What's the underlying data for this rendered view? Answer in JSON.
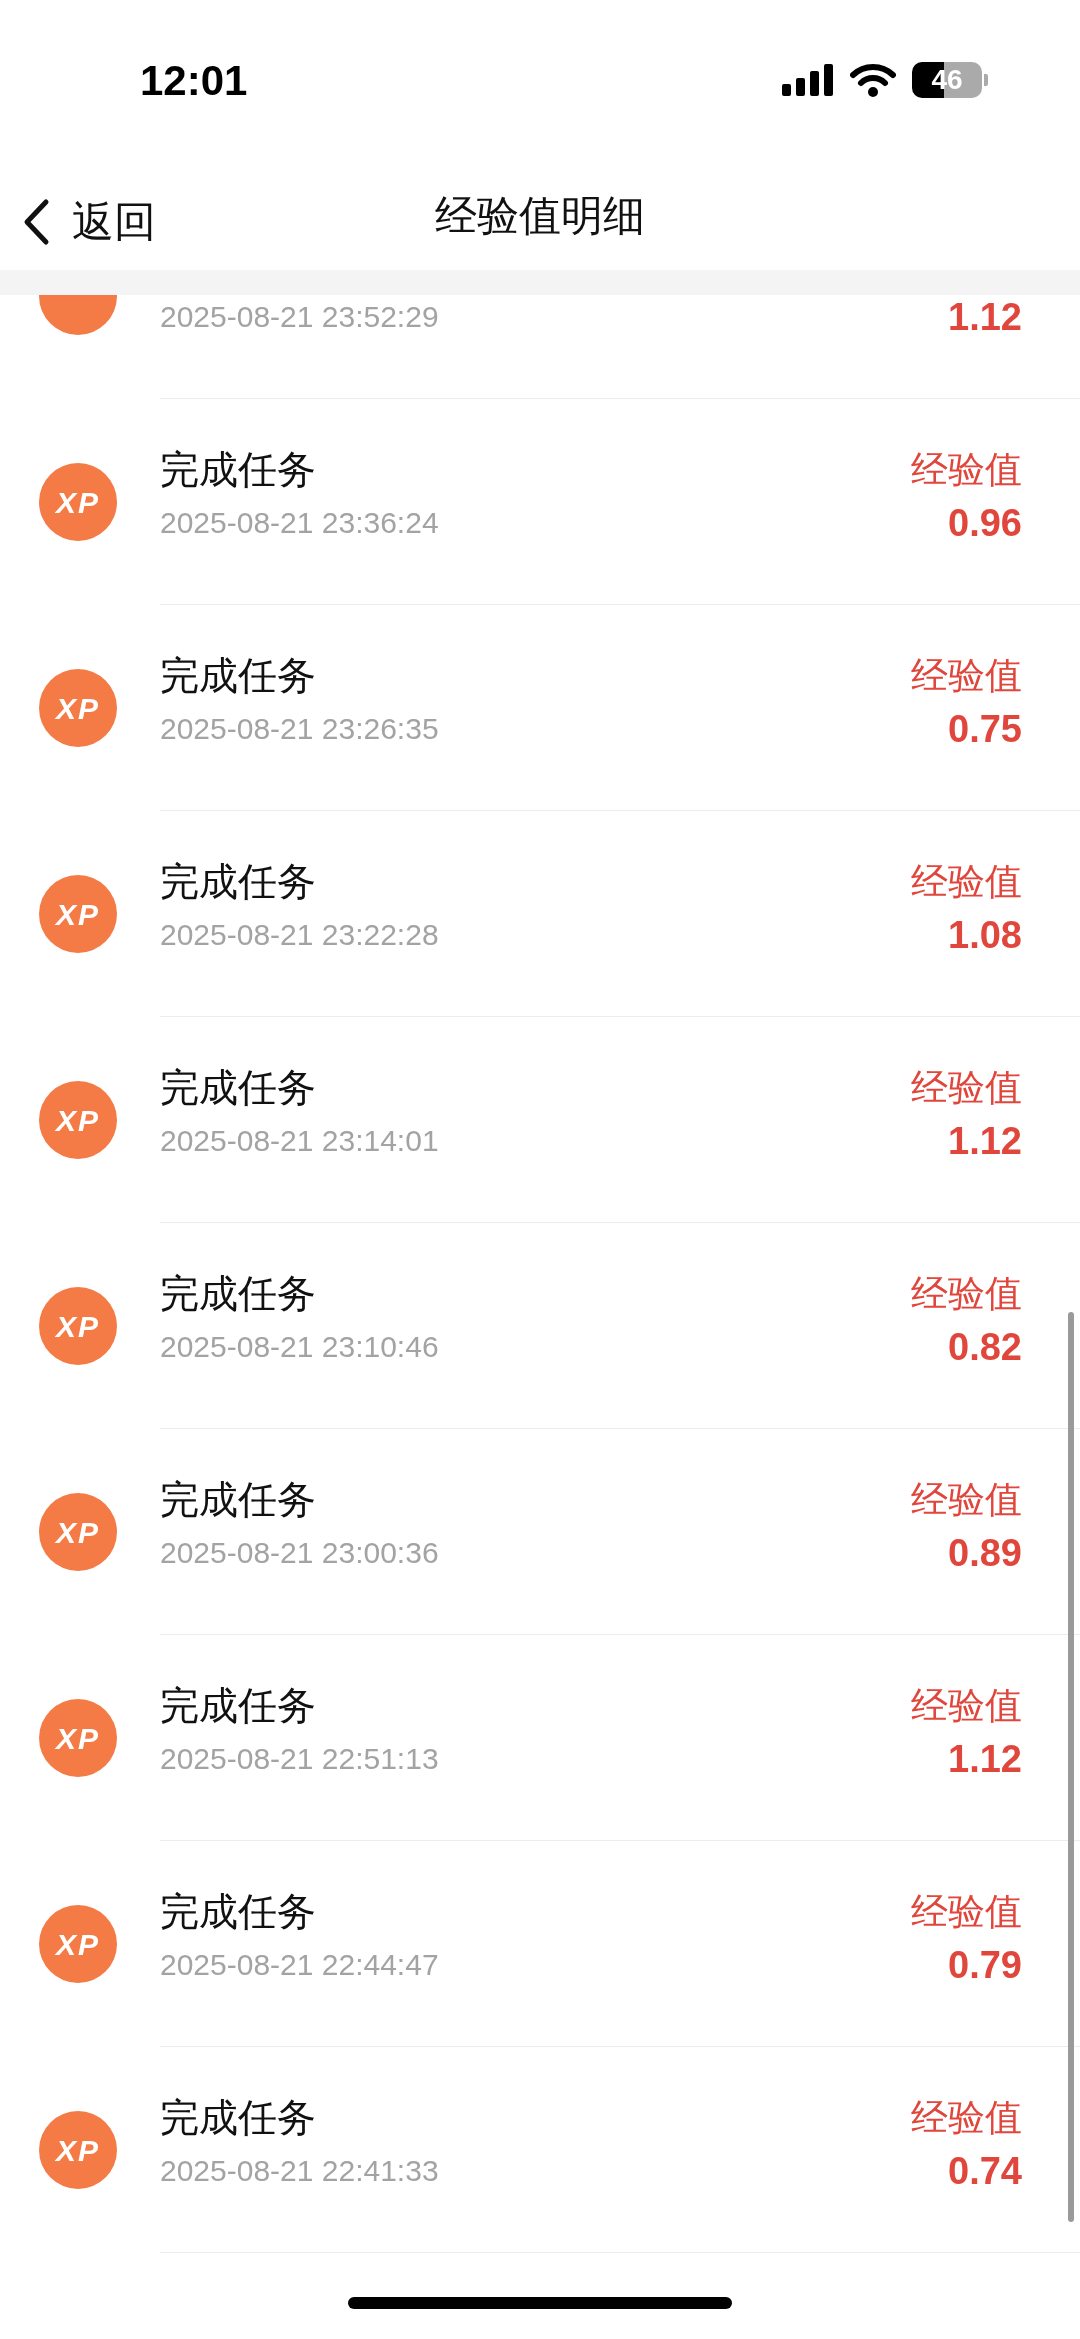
{
  "status_bar": {
    "time": "12:01",
    "battery": "46"
  },
  "nav": {
    "back": "返回",
    "title": "经验值明细"
  },
  "records": [
    {
      "time": "2025-08-21 23:52:29",
      "value": "1.12"
    },
    {
      "badge": "XP",
      "title": "完成任务",
      "time": "2025-08-21 23:36:24",
      "label": "经验值",
      "value": "0.96"
    },
    {
      "badge": "XP",
      "title": "完成任务",
      "time": "2025-08-21 23:26:35",
      "label": "经验值",
      "value": "0.75"
    },
    {
      "badge": "XP",
      "title": "完成任务",
      "time": "2025-08-21 23:22:28",
      "label": "经验值",
      "value": "1.08"
    },
    {
      "badge": "XP",
      "title": "完成任务",
      "time": "2025-08-21 23:14:01",
      "label": "经验值",
      "value": "1.12"
    },
    {
      "badge": "XP",
      "title": "完成任务",
      "time": "2025-08-21 23:10:46",
      "label": "经验值",
      "value": "0.82"
    },
    {
      "badge": "XP",
      "title": "完成任务",
      "time": "2025-08-21 23:00:36",
      "label": "经验值",
      "value": "0.89"
    },
    {
      "badge": "XP",
      "title": "完成任务",
      "time": "2025-08-21 22:51:13",
      "label": "经验值",
      "value": "1.12"
    },
    {
      "badge": "XP",
      "title": "完成任务",
      "time": "2025-08-21 22:44:47",
      "label": "经验值",
      "value": "0.79"
    },
    {
      "badge": "XP",
      "title": "完成任务",
      "time": "2025-08-21 22:41:33",
      "label": "经验值",
      "value": "0.74"
    }
  ]
}
